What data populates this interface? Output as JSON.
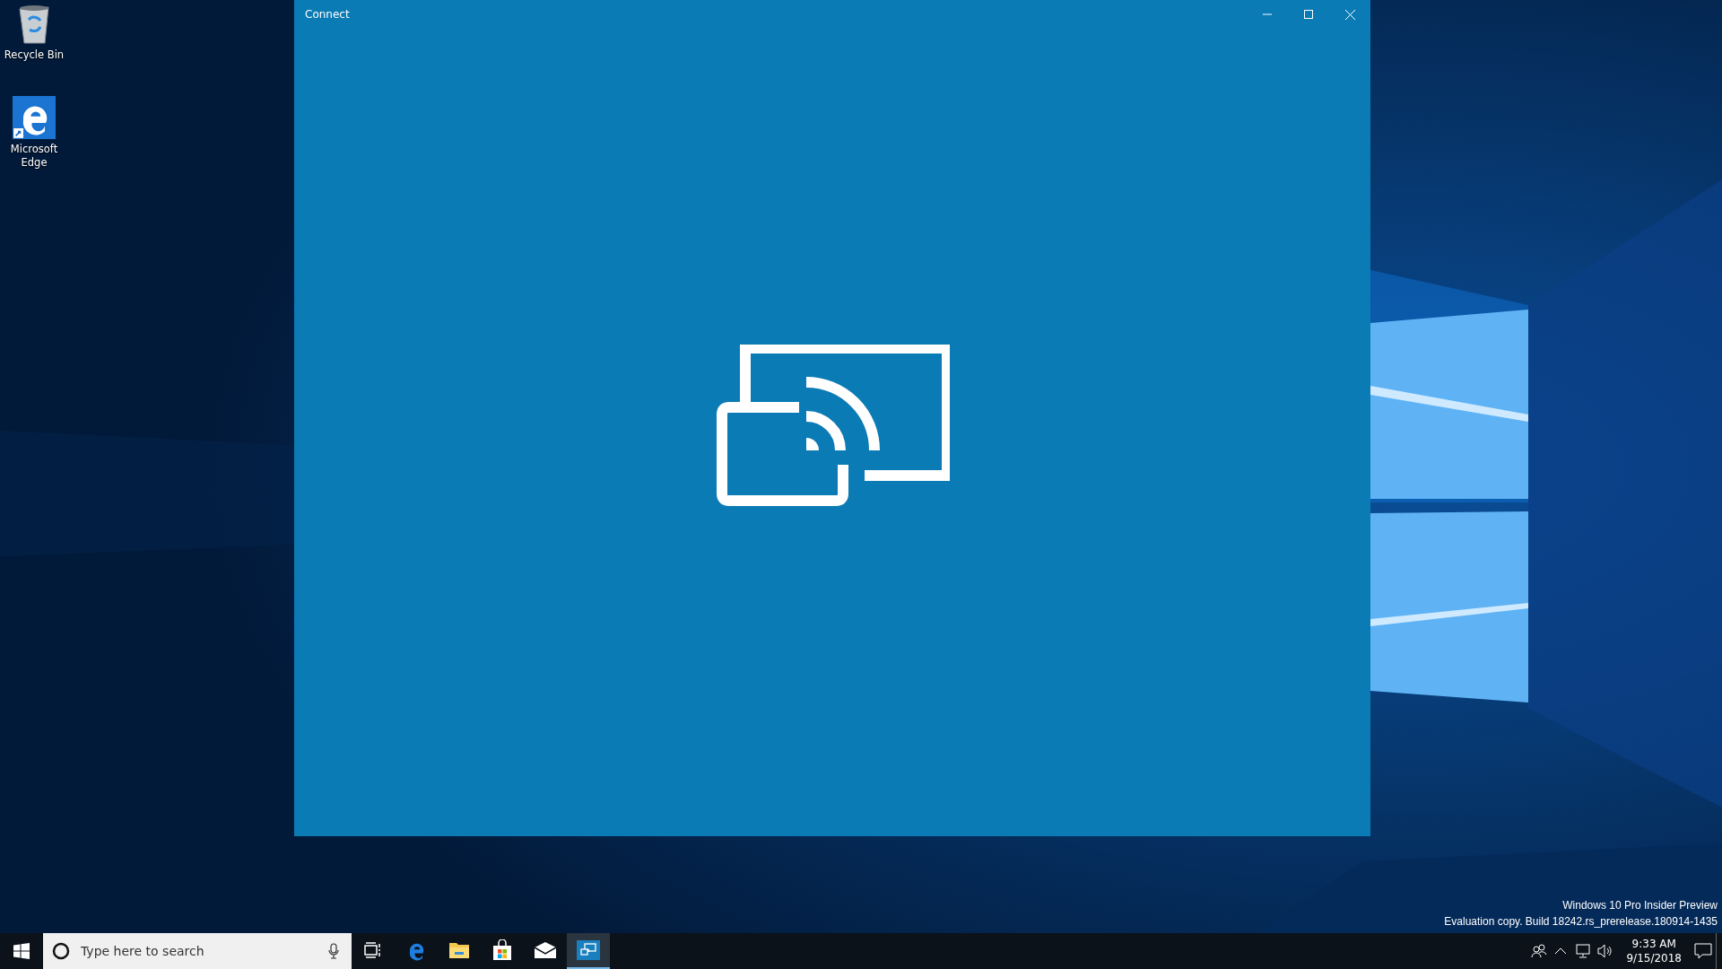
{
  "desktop_icons": [
    {
      "kind": "recycle",
      "label": "Recycle Bin"
    },
    {
      "kind": "edge",
      "label": "Microsoft Edge"
    }
  ],
  "window": {
    "title": "Connect"
  },
  "system_notice": [
    "Windows 10 Pro Insider Preview",
    "Evaluation copy. Build 18242.rs_prerelease.180914-1435"
  ],
  "taskbar": {
    "search": {
      "placeholder": "Type here to search"
    },
    "apps": [
      {
        "kind": "task-view",
        "selected": false
      },
      {
        "kind": "edge",
        "selected": false
      },
      {
        "kind": "explorer",
        "selected": false
      },
      {
        "kind": "store",
        "selected": false
      },
      {
        "kind": "mail",
        "selected": false
      },
      {
        "kind": "connect",
        "selected": true
      }
    ],
    "clock": {
      "time": "9:33 AM",
      "date": "9/15/2018"
    }
  }
}
